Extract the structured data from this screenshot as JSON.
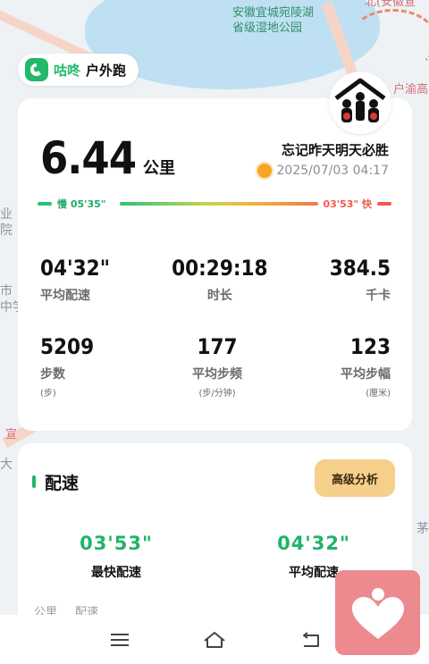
{
  "map": {
    "lake_label": "安徽宜城宛陵湖\n省级湿地公园",
    "top_right_label": "北(安徽宣",
    "road_label": "户渝高",
    "left_labels": [
      "业",
      "院",
      "市",
      "中学",
      "宣",
      "大"
    ],
    "right_label": "茅"
  },
  "brand": {
    "name": "咕咚",
    "mode": "户外跑",
    "logo_icon": "gudong-logo-icon",
    "color": "#21b96a"
  },
  "summary": {
    "distance_value": "6.44",
    "distance_unit": "公里",
    "slogan": "忘记昨天明天必胜",
    "weather_icon": "sun-icon",
    "datetime": "2025/07/03 04:17"
  },
  "pace_range": {
    "slow_label": "慢 05'35\"",
    "fast_label": "03'53\" 快",
    "slow_color": "#25c27a",
    "fast_color": "#ef5a4a"
  },
  "stats_row1": [
    {
      "value": "04'32\"",
      "label": "平均配速",
      "sub": ""
    },
    {
      "value": "00:29:18",
      "label": "时长",
      "sub": ""
    },
    {
      "value": "384.5",
      "label": "千卡",
      "sub": ""
    }
  ],
  "stats_row2": [
    {
      "value": "5209",
      "label": "步数",
      "sub": "(步)"
    },
    {
      "value": "177",
      "label": "平均步频",
      "sub": "(步/分钟)"
    },
    {
      "value": "123",
      "label": "平均步幅",
      "sub": "(厘米)"
    }
  ],
  "pace_section": {
    "title": "配速",
    "advanced_button": "高级分析",
    "fastest_value": "03'53\"",
    "fastest_label": "最快配速",
    "average_value": "04'32\"",
    "average_label": "平均配速",
    "table_headers": [
      "公里",
      "配速"
    ]
  },
  "navbar": {
    "items": [
      "menu-icon",
      "home-icon",
      "back-icon"
    ]
  },
  "floating_button": {
    "icon": "heart-person-icon",
    "color": "#ec8a90"
  }
}
